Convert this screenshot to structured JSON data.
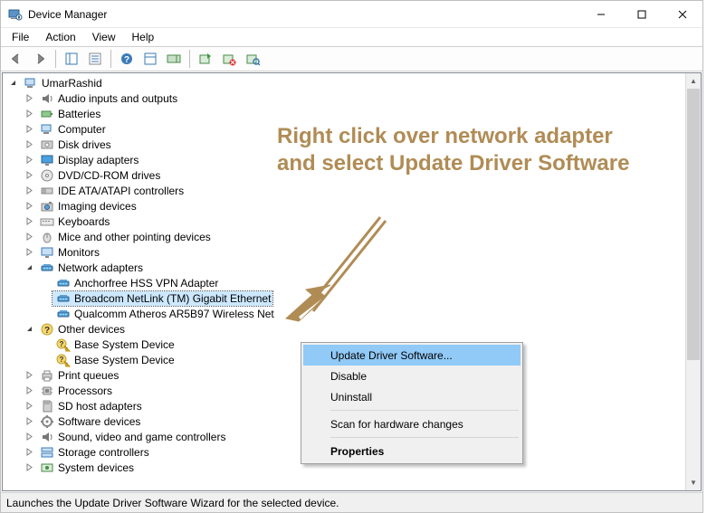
{
  "window": {
    "title": "Device Manager"
  },
  "menubar": [
    "File",
    "Action",
    "View",
    "Help"
  ],
  "tree": {
    "root": "UmarRashid",
    "nodes": [
      {
        "label": "Audio inputs and outputs",
        "icon": "audio",
        "expanded": false,
        "level": 1
      },
      {
        "label": "Batteries",
        "icon": "battery",
        "expanded": false,
        "level": 1
      },
      {
        "label": "Computer",
        "icon": "computer",
        "expanded": false,
        "level": 1
      },
      {
        "label": "Disk drives",
        "icon": "disk",
        "expanded": false,
        "level": 1
      },
      {
        "label": "Display adapters",
        "icon": "display",
        "expanded": false,
        "level": 1
      },
      {
        "label": "DVD/CD-ROM drives",
        "icon": "dvd",
        "expanded": false,
        "level": 1
      },
      {
        "label": "IDE ATA/ATAPI controllers",
        "icon": "ide",
        "expanded": false,
        "level": 1
      },
      {
        "label": "Imaging devices",
        "icon": "imaging",
        "expanded": false,
        "level": 1
      },
      {
        "label": "Keyboards",
        "icon": "keyboard",
        "expanded": false,
        "level": 1
      },
      {
        "label": "Mice and other pointing devices",
        "icon": "mouse",
        "expanded": false,
        "level": 1
      },
      {
        "label": "Monitors",
        "icon": "monitor",
        "expanded": false,
        "level": 1
      },
      {
        "label": "Network adapters",
        "icon": "network",
        "expanded": true,
        "level": 1
      },
      {
        "label": "Anchorfree HSS VPN Adapter",
        "icon": "network",
        "expanded": null,
        "level": 2
      },
      {
        "label": "Broadcom NetLink (TM) Gigabit Ethernet",
        "icon": "network",
        "expanded": null,
        "level": 2,
        "selected": true
      },
      {
        "label": "Qualcomm Atheros AR5B97 Wireless Net",
        "icon": "network",
        "expanded": null,
        "level": 2
      },
      {
        "label": "Other devices",
        "icon": "other",
        "expanded": true,
        "level": 1
      },
      {
        "label": "Base System Device",
        "icon": "other-warn",
        "expanded": null,
        "level": 2
      },
      {
        "label": "Base System Device",
        "icon": "other-warn",
        "expanded": null,
        "level": 2
      },
      {
        "label": "Print queues",
        "icon": "printer",
        "expanded": false,
        "level": 1
      },
      {
        "label": "Processors",
        "icon": "cpu",
        "expanded": false,
        "level": 1
      },
      {
        "label": "SD host adapters",
        "icon": "sd",
        "expanded": false,
        "level": 1
      },
      {
        "label": "Software devices",
        "icon": "software",
        "expanded": false,
        "level": 1
      },
      {
        "label": "Sound, video and game controllers",
        "icon": "audio",
        "expanded": false,
        "level": 1
      },
      {
        "label": "Storage controllers",
        "icon": "storage",
        "expanded": false,
        "level": 1
      },
      {
        "label": "System devices",
        "icon": "system",
        "expanded": false,
        "level": 1
      }
    ]
  },
  "context": {
    "items": [
      {
        "label": "Update Driver Software...",
        "hover": true
      },
      {
        "label": "Disable"
      },
      {
        "label": "Uninstall"
      },
      {
        "sep": true
      },
      {
        "label": "Scan for hardware changes"
      },
      {
        "sep": true
      },
      {
        "label": "Properties",
        "bold": true
      }
    ]
  },
  "statusbar": "Launches the Update Driver Software Wizard for the selected device.",
  "annotation": "Right click over network adapter and select Update Driver Software",
  "colors": {
    "annotation": "#b08c55"
  },
  "icons": {
    "computer": "computer-icon",
    "audio": "speaker-icon",
    "battery": "battery-icon",
    "disk": "disk-icon",
    "display": "display-icon",
    "dvd": "disc-icon",
    "ide": "ide-icon",
    "imaging": "camera-icon",
    "keyboard": "keyboard-icon",
    "mouse": "mouse-icon",
    "monitor": "monitor-icon",
    "network": "network-icon",
    "other": "warning-icon",
    "other-warn": "warning-icon",
    "printer": "printer-icon",
    "cpu": "chip-icon",
    "sd": "sd-icon",
    "software": "gear-icon",
    "storage": "storage-icon",
    "system": "system-icon"
  }
}
